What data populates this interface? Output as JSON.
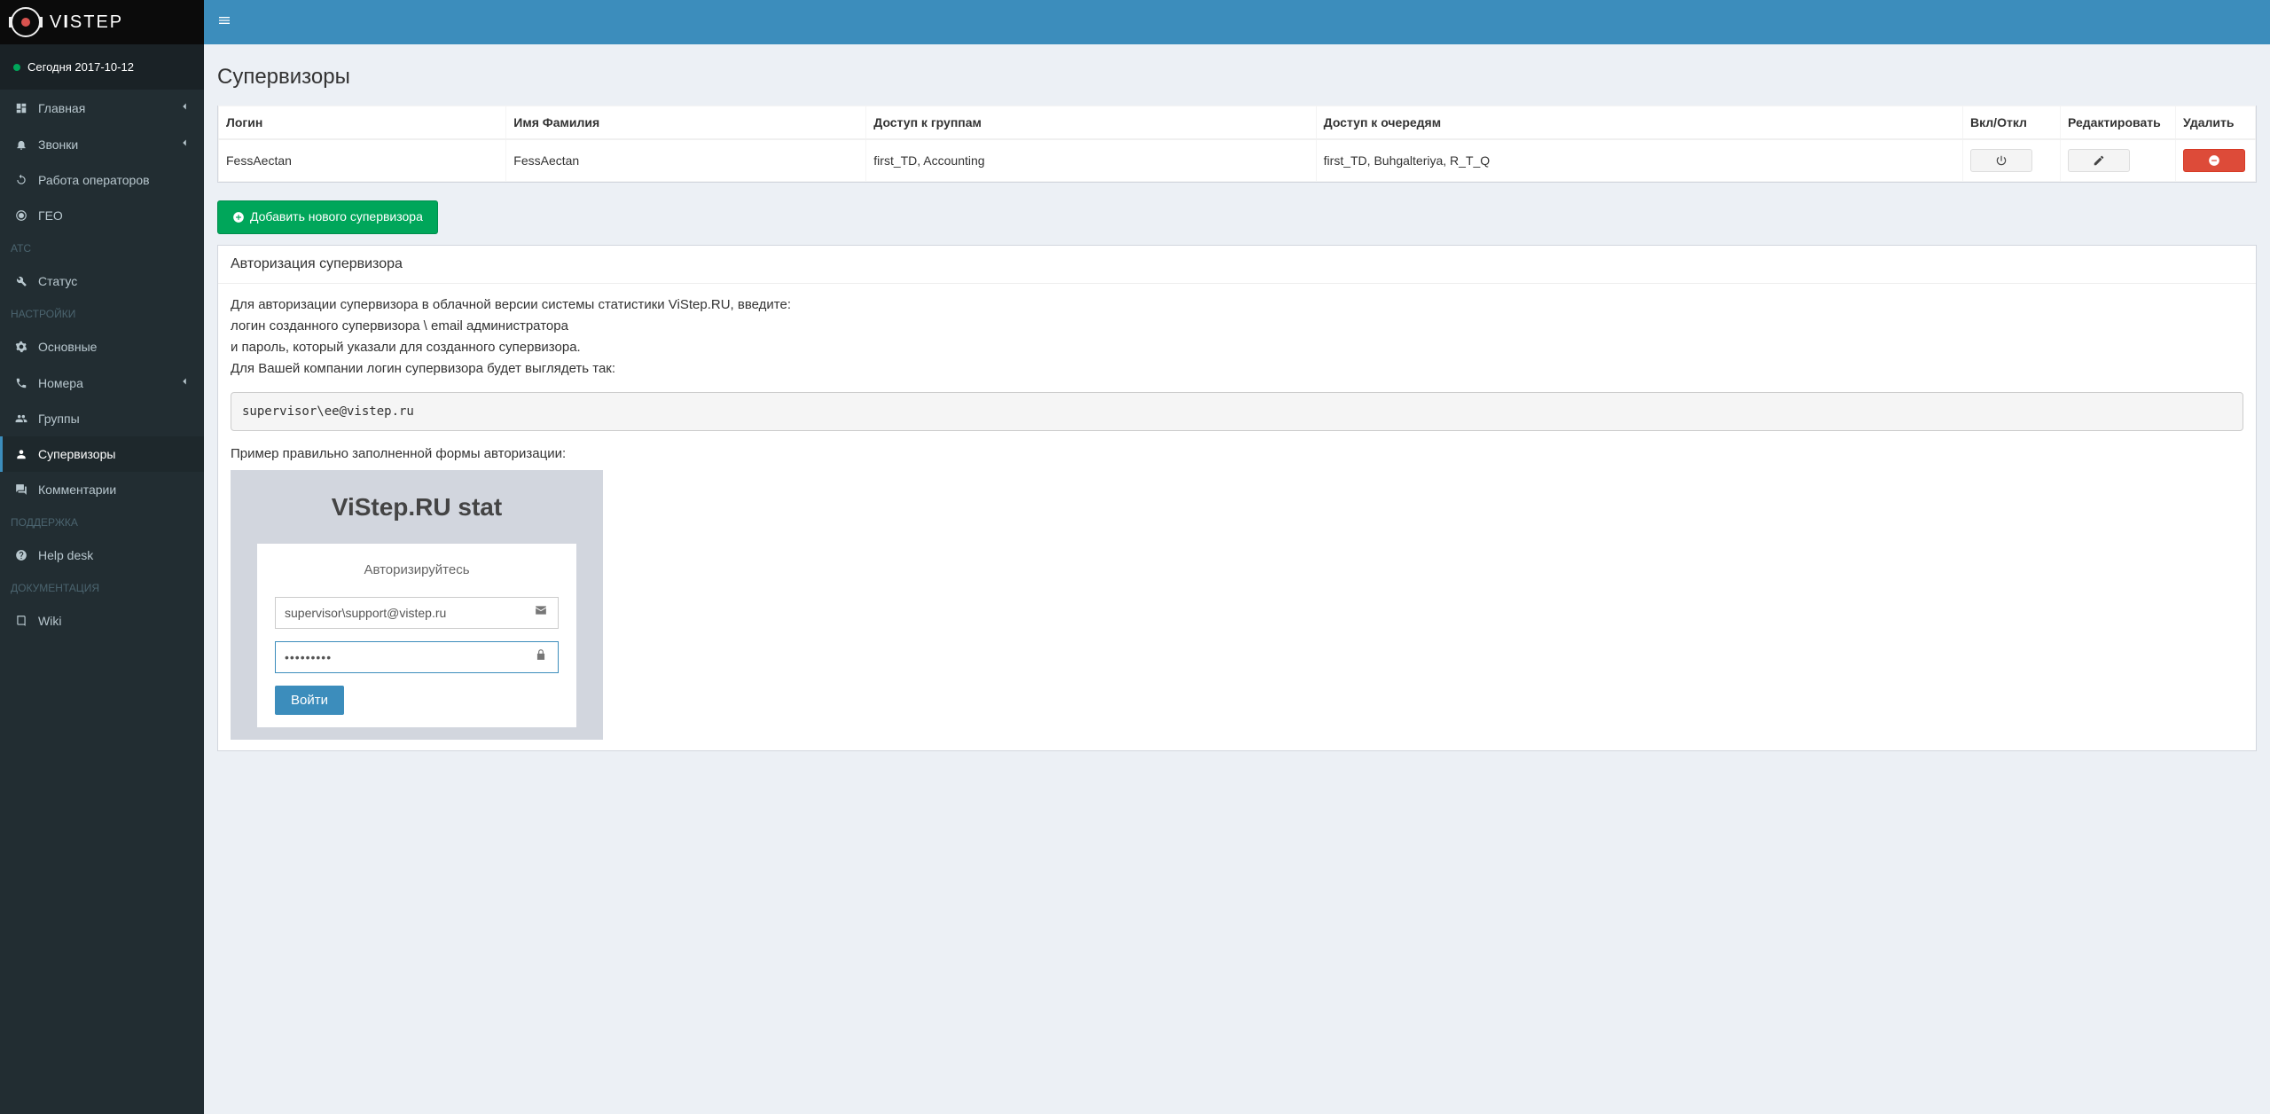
{
  "brand": {
    "name_left": "V",
    "name_mid": "I",
    "name_right": "STEP"
  },
  "date_label": "Сегодня 2017-10-12",
  "sidebar": {
    "items": [
      {
        "label": "Главная",
        "icon": "dashboard",
        "caret": true
      },
      {
        "label": "Звонки",
        "icon": "bell",
        "caret": true
      },
      {
        "label": "Работа операторов",
        "icon": "refresh",
        "caret": false
      },
      {
        "label": "ГЕО",
        "icon": "globe",
        "caret": false
      }
    ],
    "group_atc": "АТС",
    "atc_items": [
      {
        "label": "Статус",
        "icon": "wrench"
      }
    ],
    "group_settings": "НАСТРОЙКИ",
    "settings_items": [
      {
        "label": "Основные",
        "icon": "cog",
        "caret": false
      },
      {
        "label": "Номера",
        "icon": "phone",
        "caret": true
      },
      {
        "label": "Группы",
        "icon": "users",
        "caret": false
      },
      {
        "label": "Супервизоры",
        "icon": "person",
        "caret": false,
        "active": true
      },
      {
        "label": "Комментарии",
        "icon": "comments",
        "caret": false
      }
    ],
    "group_support": "ПОДДЕРЖКА",
    "support_items": [
      {
        "label": "Help desk",
        "icon": "question"
      }
    ],
    "group_docs": "ДОКУМЕНТАЦИЯ",
    "docs_items": [
      {
        "label": "Wiki",
        "icon": "book"
      }
    ]
  },
  "page": {
    "title": "Супервизоры"
  },
  "table": {
    "headers": {
      "login": "Логин",
      "name": "Имя Фамилия",
      "groups": "Доступ к группам",
      "queues": "Доступ к очередям",
      "toggle": "Вкл/Откл",
      "edit": "Редактировать",
      "delete": "Удалить"
    },
    "rows": [
      {
        "login": "FessAectan",
        "name": "FessAectan",
        "groups": "first_TD, Accounting",
        "queues": "first_TD, Buhgalteriya, R_T_Q"
      }
    ]
  },
  "add_button": "Добавить нового супервизора",
  "auth_panel": {
    "title": "Авторизация супервизора",
    "line1": "Для авторизации супервизора в облачной версии системы статистики ViStep.RU, введите:",
    "line2": "логин созданного супервизора \\ email администратора",
    "line3": "и пароль, который указали для созданного супервизора.",
    "line4": "Для Вашей компании логин супервизора будет выглядеть так:",
    "code": "supervisor\\ee@vistep.ru",
    "example_label": "Пример правильно заполненной формы авторизации:"
  },
  "example_form": {
    "title": "ViStep.RU stat",
    "subtitle": "Авторизируйтесь",
    "login_value": "supervisor\\support@vistep.ru",
    "password_value": "•••••••••",
    "submit": "Войти"
  }
}
